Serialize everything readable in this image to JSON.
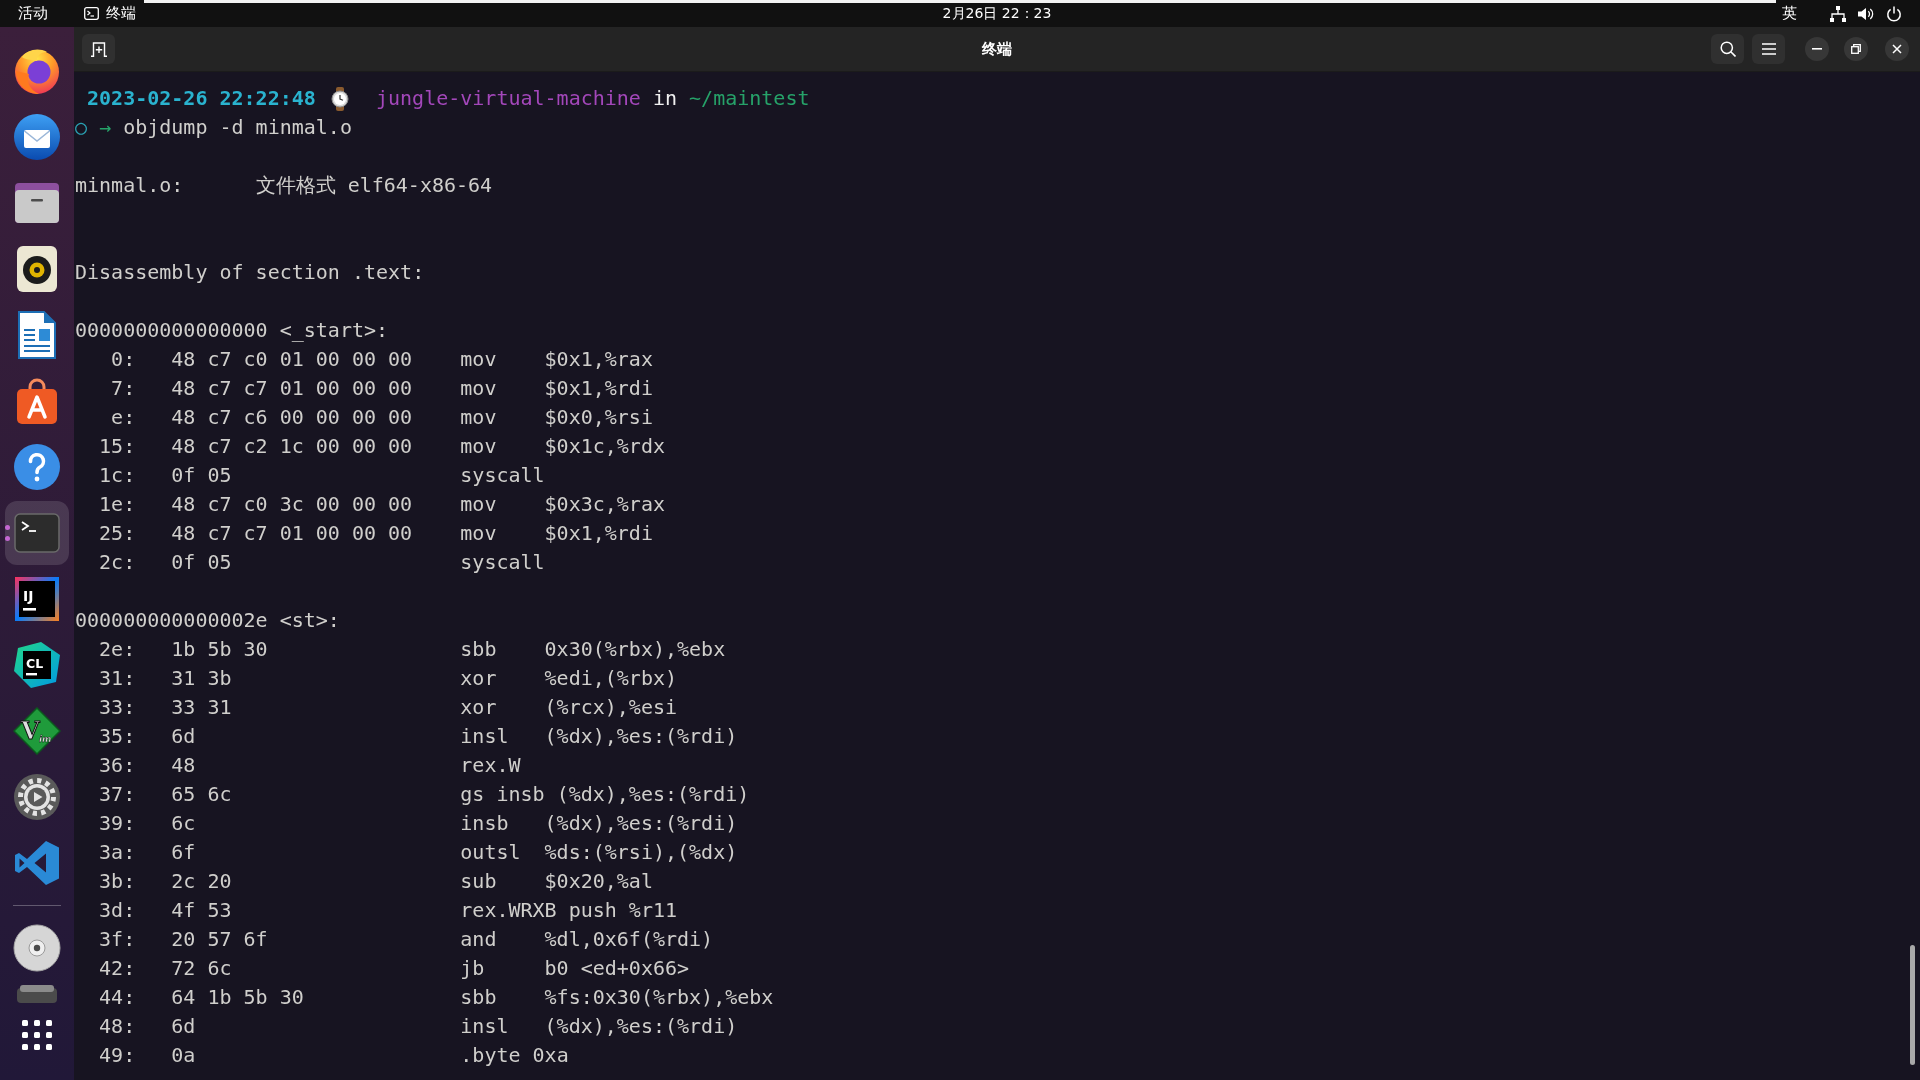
{
  "top_bar": {
    "activities": "活动",
    "app_name": "终端",
    "clock": "2月26日 22：23",
    "input_method": "英"
  },
  "dock": {
    "apps": [
      {
        "kind": "browser",
        "selected": false,
        "running": false
      },
      {
        "kind": "mail",
        "selected": false,
        "running": false
      },
      {
        "kind": "files",
        "selected": false,
        "running": false
      },
      {
        "kind": "music",
        "selected": false,
        "running": false
      },
      {
        "kind": "writer",
        "selected": false,
        "running": false
      },
      {
        "kind": "store",
        "selected": false,
        "running": false
      },
      {
        "kind": "help",
        "selected": false,
        "running": false
      },
      {
        "kind": "terminal",
        "selected": true,
        "running": true
      },
      {
        "kind": "intellij",
        "selected": false,
        "running": false,
        "logo_text": "IJ"
      },
      {
        "kind": "clion",
        "selected": false,
        "running": false,
        "logo_text": "CL"
      },
      {
        "kind": "vim",
        "selected": false,
        "running": false,
        "logo_text": "V",
        "logo_subtext": "im"
      },
      {
        "kind": "settings",
        "selected": false,
        "running": false
      },
      {
        "kind": "vscode",
        "selected": false,
        "running": false
      }
    ],
    "devices": [
      {
        "kind": "disc"
      },
      {
        "kind": "drive"
      }
    ]
  },
  "window": {
    "title": "终端"
  },
  "terminal": {
    "prompt": {
      "timestamp": "2023-02-26 22:22:48",
      "host": "jungle-virtual-machine",
      "connector": "in",
      "path": "~/maintest"
    },
    "command": {
      "status": "○",
      "arrow": "→",
      "text": "objdump -d minmal.o"
    },
    "output": [
      {
        "kind": "blank"
      },
      {
        "kind": "format",
        "file": "minmal.o:",
        "description": "文件格式 elf64-x86-64"
      },
      {
        "kind": "blank"
      },
      {
        "kind": "blank"
      },
      {
        "kind": "text",
        "text": "Disassembly of section .text:"
      },
      {
        "kind": "blank"
      },
      {
        "kind": "text",
        "text": "0000000000000000 <_start>:"
      },
      {
        "kind": "instruction",
        "offset": "0:",
        "bytes": "48 c7 c0 01 00 00 00",
        "mnemonic": "mov",
        "operands": "$0x1,%rax"
      },
      {
        "kind": "instruction",
        "offset": "7:",
        "bytes": "48 c7 c7 01 00 00 00",
        "mnemonic": "mov",
        "operands": "$0x1,%rdi"
      },
      {
        "kind": "instruction",
        "offset": "e:",
        "bytes": "48 c7 c6 00 00 00 00",
        "mnemonic": "mov",
        "operands": "$0x0,%rsi"
      },
      {
        "kind": "instruction",
        "offset": "15:",
        "bytes": "48 c7 c2 1c 00 00 00",
        "mnemonic": "mov",
        "operands": "$0x1c,%rdx"
      },
      {
        "kind": "instruction",
        "offset": "1c:",
        "bytes": "0f 05",
        "mnemonic": "syscall"
      },
      {
        "kind": "instruction",
        "offset": "1e:",
        "bytes": "48 c7 c0 3c 00 00 00",
        "mnemonic": "mov",
        "operands": "$0x3c,%rax"
      },
      {
        "kind": "instruction",
        "offset": "25:",
        "bytes": "48 c7 c7 01 00 00 00",
        "mnemonic": "mov",
        "operands": "$0x1,%rdi"
      },
      {
        "kind": "instruction",
        "offset": "2c:",
        "bytes": "0f 05",
        "mnemonic": "syscall"
      },
      {
        "kind": "blank"
      },
      {
        "kind": "text",
        "text": "000000000000002e <st>:"
      },
      {
        "kind": "instruction",
        "offset": "2e:",
        "bytes": "1b 5b 30",
        "mnemonic": "sbb",
        "operands": "0x30(%rbx),%ebx"
      },
      {
        "kind": "instruction",
        "offset": "31:",
        "bytes": "31 3b",
        "mnemonic": "xor",
        "operands": "%edi,(%rbx)"
      },
      {
        "kind": "instruction",
        "offset": "33:",
        "bytes": "33 31",
        "mnemonic": "xor",
        "operands": "(%rcx),%esi"
      },
      {
        "kind": "instruction",
        "offset": "35:",
        "bytes": "6d",
        "mnemonic": "insl",
        "operands": "(%dx),%es:(%rdi)"
      },
      {
        "kind": "instruction",
        "offset": "36:",
        "bytes": "48",
        "mnemonic": "rex.W"
      },
      {
        "kind": "instruction",
        "offset": "37:",
        "bytes": "65 6c",
        "mnemonic": "gs insb",
        "operands": "(%dx),%es:(%rdi)"
      },
      {
        "kind": "instruction",
        "offset": "39:",
        "bytes": "6c",
        "mnemonic": "insb",
        "operands": "(%dx),%es:(%rdi)"
      },
      {
        "kind": "instruction",
        "offset": "3a:",
        "bytes": "6f",
        "mnemonic": "outsl",
        "operands": "%ds:(%rsi),(%dx)"
      },
      {
        "kind": "instruction",
        "offset": "3b:",
        "bytes": "2c 20",
        "mnemonic": "sub",
        "operands": "$0x20,%al"
      },
      {
        "kind": "instruction",
        "offset": "3d:",
        "bytes": "4f 53",
        "mnemonic": "rex.WRXB",
        "operands": "push %r11"
      },
      {
        "kind": "instruction",
        "offset": "3f:",
        "bytes": "20 57 6f",
        "mnemonic": "and",
        "operands": "%dl,0x6f(%rdi)"
      },
      {
        "kind": "instruction",
        "offset": "42:",
        "bytes": "72 6c",
        "mnemonic": "jb",
        "operands": "b0 <ed+0x66>"
      },
      {
        "kind": "instruction",
        "offset": "44:",
        "bytes": "64 1b 5b 30",
        "mnemonic": "sbb",
        "operands": "%fs:0x30(%rbx),%ebx"
      },
      {
        "kind": "instruction",
        "offset": "48:",
        "bytes": "6d",
        "mnemonic": "insl",
        "operands": "(%dx),%es:(%rdi)"
      },
      {
        "kind": "instruction",
        "offset": "49:",
        "bytes": "0a",
        "mnemonic": ".byte 0xa"
      }
    ]
  }
}
